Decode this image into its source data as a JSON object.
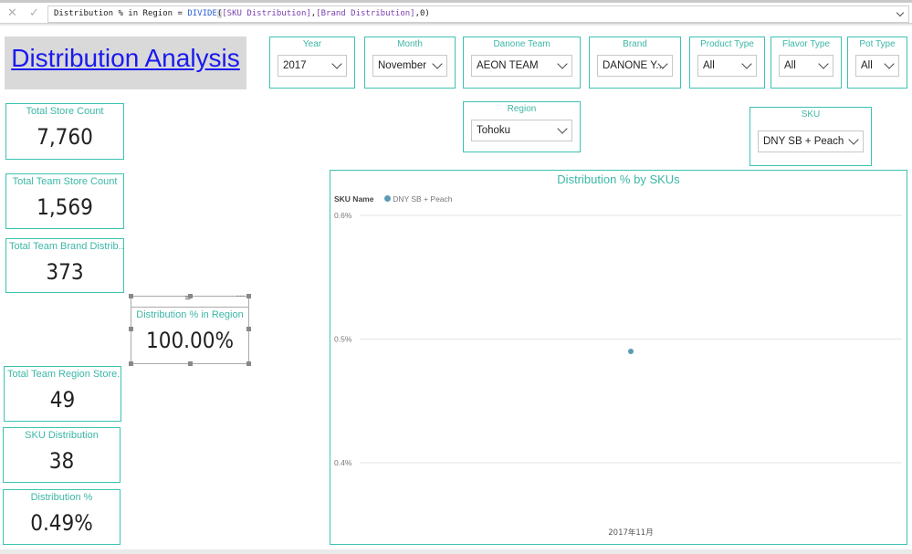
{
  "formula_bar": {
    "measure": "Distribution % in Region = ",
    "func": "DIVIDE",
    "arg1": "[SKU Distribution]",
    "sep": ",",
    "arg2": "[Brand Distribution]",
    "tail": ",0)",
    "open": "(",
    "cancel_icon": "x-icon",
    "commit_icon": "check-icon"
  },
  "title": "Distribution Analysis",
  "slicers": [
    {
      "label": "Year",
      "value": "2017"
    },
    {
      "label": "Month",
      "value": "November"
    },
    {
      "label": "Danone Team",
      "value": "AEON TEAM"
    },
    {
      "label": "Brand",
      "value": "DANONE Y..."
    },
    {
      "label": "Product Type",
      "value": "All"
    },
    {
      "label": "Flavor Type",
      "value": "All"
    },
    {
      "label": "Pot Type",
      "value": "All"
    },
    {
      "label": "Region",
      "value": "Tohoku"
    },
    {
      "label": "SKU",
      "value": "DNY SB + Peach"
    }
  ],
  "cards": [
    {
      "label": "Total Store Count",
      "value": "7,760"
    },
    {
      "label": "Total Team Store Count",
      "value": "1,569"
    },
    {
      "label": "Total Team Brand Distrib...",
      "value": "373"
    },
    {
      "label": "Distribution % in Region",
      "value": "100.00%"
    },
    {
      "label": "Total Team Region Store...",
      "value": "49"
    },
    {
      "label": "SKU Distribution",
      "value": "38"
    },
    {
      "label": "Distribution %",
      "value": "0.49%"
    }
  ],
  "chart_data": {
    "type": "scatter",
    "title": "Distribution % by SKUs",
    "legend_title": "SKU Name",
    "legend_placement": "top-left",
    "series": [
      {
        "name": "DNY SB + Peach",
        "color": "#5b9bb5",
        "points": [
          {
            "x": "2017年11月",
            "y": 0.49
          }
        ]
      }
    ],
    "categories": [
      "2017年11月"
    ],
    "y_ticks": [
      "0.6%",
      "0.5%",
      "0.4%"
    ],
    "ylim": [
      0.4,
      0.6
    ],
    "grid": true
  }
}
